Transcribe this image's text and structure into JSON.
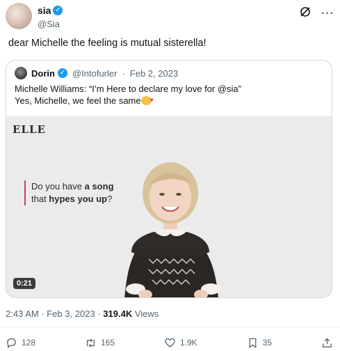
{
  "author": {
    "display_name": "sia",
    "handle": "@Sia"
  },
  "tweet": {
    "text": "dear Michelle the feeling is mutual sisterella!"
  },
  "quoted": {
    "display_name": "Dorin",
    "handle": "@Intofurler",
    "separator": "·",
    "date": "Feb 2, 2023",
    "text_line1": "Michelle Williams: “I’m Here to declare my love for @sia”",
    "text_line2": "Yes, Michelle, we feel the same",
    "video": {
      "brand": "ELLE",
      "caption_part1": "Do you have ",
      "caption_bold1": "a song",
      "caption_part2": "that ",
      "caption_bold2": "hypes you up",
      "caption_end": "?",
      "duration": "0:21"
    }
  },
  "meta": {
    "time": "2:43 AM",
    "separator1": "·",
    "date": "Feb 3, 2023",
    "separator2": "·",
    "views_count": "319.4K",
    "views_label": "Views"
  },
  "actions": {
    "replies": "128",
    "reposts": "165",
    "likes": "1.9K",
    "bookmarks": "35"
  },
  "icons": {
    "verified": "verified-badge-icon",
    "grok": "grok-icon",
    "more": "more-icon",
    "reply": "reply-icon",
    "repost": "repost-icon",
    "like": "heart-icon",
    "bookmark": "bookmark-icon",
    "share": "share-icon"
  },
  "colors": {
    "accent": "#1d9bf0",
    "secondary_text": "#536471",
    "caption_bar": "#c43a7c"
  }
}
